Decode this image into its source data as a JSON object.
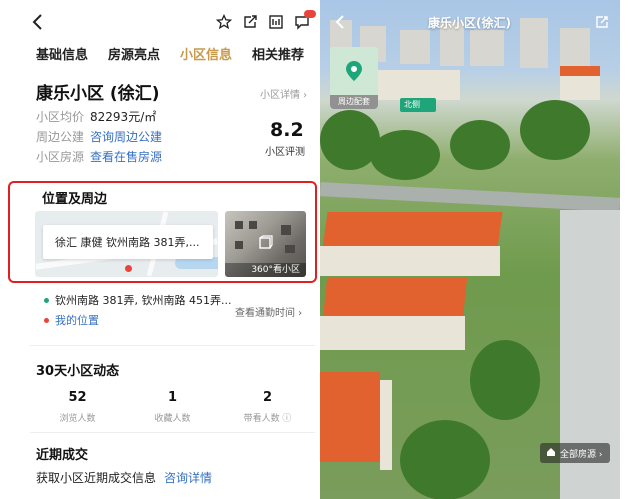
{
  "header": {
    "icons": [
      "back-icon",
      "star-icon",
      "share-icon",
      "compare-icon",
      "message-icon"
    ]
  },
  "tabs": [
    {
      "label": "基础信息",
      "active": false
    },
    {
      "label": "房源亮点",
      "active": false
    },
    {
      "label": "小区信息",
      "active": true
    },
    {
      "label": "相关推荐",
      "active": false
    }
  ],
  "community": {
    "name": "康乐小区 (徐汇)",
    "detail_link": "小区详情 ›",
    "avg_price_label": "小区均价",
    "avg_price_value": "82293元/㎡",
    "nearby_label": "周边公建",
    "nearby_link": "咨询周边公建",
    "listing_label": "小区房源",
    "listing_link": "查看在售房源",
    "score": "8.2",
    "score_label": "小区评测"
  },
  "location": {
    "section_title": "位置及周边",
    "map_address": "徐汇 康健 钦州南路 381弄,...",
    "view_360_label": "360°看小区",
    "address_line": "钦州南路 381弄, 钦州南路 451弄...",
    "my_location": "我的位置",
    "commute_link": "查看通勤时间 ›"
  },
  "activity": {
    "section_title": "30天小区动态",
    "stats": [
      {
        "value": "52",
        "label": "浏览人数"
      },
      {
        "value": "1",
        "label": "收藏人数"
      },
      {
        "value": "2",
        "label": "带看人数 ⓘ"
      }
    ]
  },
  "deals": {
    "section_title": "近期成交",
    "text": "获取小区近期成交信息",
    "link": "咨询详情"
  },
  "street_view": {
    "title": "康乐小区(徐汇)",
    "poi_label": "周边配套",
    "north_label": "北侧",
    "all_listings": "全部房源 ›"
  },
  "colors": {
    "accent": "#c79a4a",
    "link": "#3670c0",
    "highlight": "#e02020",
    "green": "#1fa57a",
    "red": "#e8443b"
  }
}
